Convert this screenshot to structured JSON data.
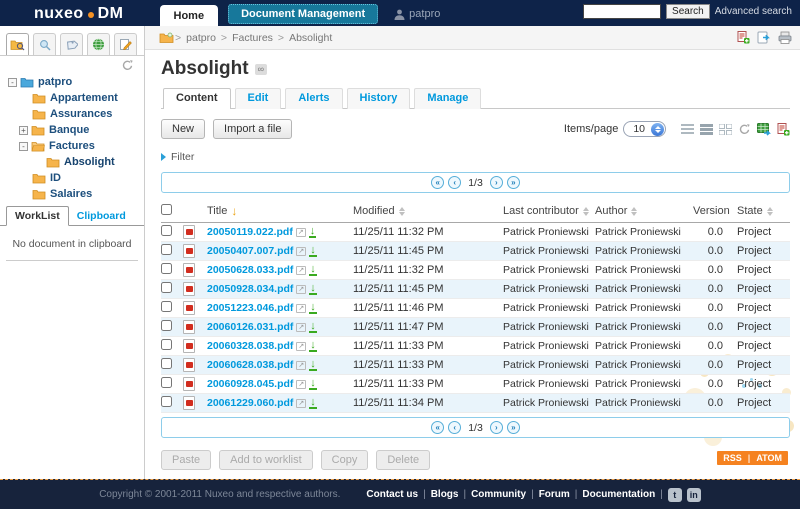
{
  "header": {
    "logo_primary": "nuxeo",
    "logo_secondary": "DM",
    "nav_tabs": [
      {
        "label": "Home"
      },
      {
        "label": "Document Management"
      }
    ],
    "username": "patpro",
    "search_button": "Search",
    "advanced_search": "Advanced search"
  },
  "breadcrumb": {
    "sep": ">",
    "items": [
      {
        "label": "patpro"
      },
      {
        "label": "Factures"
      },
      {
        "label": "Absolight"
      }
    ]
  },
  "sidebar": {
    "tree": [
      {
        "label": "patpro"
      },
      {
        "label": "Appartement"
      },
      {
        "label": "Assurances"
      },
      {
        "label": "Banque"
      },
      {
        "label": "Factures"
      },
      {
        "label": "Absolight"
      },
      {
        "label": "ID"
      },
      {
        "label": "Salaires"
      }
    ],
    "panel_tabs": [
      {
        "label": "WorkList"
      },
      {
        "label": "Clipboard"
      }
    ],
    "clipboard_empty": "No document in clipboard"
  },
  "main": {
    "title": "Absolight",
    "doc_tabs": [
      {
        "label": "Content"
      },
      {
        "label": "Edit"
      },
      {
        "label": "Alerts"
      },
      {
        "label": "History"
      },
      {
        "label": "Manage"
      }
    ],
    "new_button": "New",
    "import_button": "Import a file",
    "items_per_page_label": "Items/page",
    "items_per_page_value": "10",
    "filter_label": "Filter",
    "pagination": "1/3",
    "table": {
      "headers": {
        "title": "Title",
        "modified": "Modified",
        "contributor": "Last contributor",
        "author": "Author",
        "version": "Version",
        "state": "State"
      },
      "rows": [
        {
          "title": "20050119.022.pdf",
          "modified": "11/25/11 11:32 PM",
          "contributor": "Patrick Proniewski",
          "author": "Patrick Proniewski",
          "version": "0.0",
          "state": "Project"
        },
        {
          "title": "20050407.007.pdf",
          "modified": "11/25/11 11:45 PM",
          "contributor": "Patrick Proniewski",
          "author": "Patrick Proniewski",
          "version": "0.0",
          "state": "Project"
        },
        {
          "title": "20050628.033.pdf",
          "modified": "11/25/11 11:32 PM",
          "contributor": "Patrick Proniewski",
          "author": "Patrick Proniewski",
          "version": "0.0",
          "state": "Project"
        },
        {
          "title": "20050928.034.pdf",
          "modified": "11/25/11 11:45 PM",
          "contributor": "Patrick Proniewski",
          "author": "Patrick Proniewski",
          "version": "0.0",
          "state": "Project"
        },
        {
          "title": "20051223.046.pdf",
          "modified": "11/25/11 11:46 PM",
          "contributor": "Patrick Proniewski",
          "author": "Patrick Proniewski",
          "version": "0.0",
          "state": "Project"
        },
        {
          "title": "20060126.031.pdf",
          "modified": "11/25/11 11:47 PM",
          "contributor": "Patrick Proniewski",
          "author": "Patrick Proniewski",
          "version": "0.0",
          "state": "Project"
        },
        {
          "title": "20060328.038.pdf",
          "modified": "11/25/11 11:33 PM",
          "contributor": "Patrick Proniewski",
          "author": "Patrick Proniewski",
          "version": "0.0",
          "state": "Project"
        },
        {
          "title": "20060628.038.pdf",
          "modified": "11/25/11 11:33 PM",
          "contributor": "Patrick Proniewski",
          "author": "Patrick Proniewski",
          "version": "0.0",
          "state": "Project"
        },
        {
          "title": "20060928.045.pdf",
          "modified": "11/25/11 11:33 PM",
          "contributor": "Patrick Proniewski",
          "author": "Patrick Proniewski",
          "version": "0.0",
          "state": "Project"
        },
        {
          "title": "20061229.060.pdf",
          "modified": "11/25/11 11:34 PM",
          "contributor": "Patrick Proniewski",
          "author": "Patrick Proniewski",
          "version": "0.0",
          "state": "Project"
        }
      ]
    },
    "actions": [
      {
        "label": "Paste"
      },
      {
        "label": "Add to worklist"
      },
      {
        "label": "Copy"
      },
      {
        "label": "Delete"
      }
    ],
    "rss_label": "RSS",
    "atom_label": "ATOM"
  },
  "footer": {
    "copyright": "Copyright © 2001-2011 Nuxeo and respective authors.",
    "separator": "|",
    "links": [
      {
        "label": "Contact us"
      },
      {
        "label": "Blogs"
      },
      {
        "label": "Community"
      },
      {
        "label": "Forum"
      },
      {
        "label": "Documentation"
      }
    ]
  },
  "icons": {
    "collapse": "-",
    "expand": "+",
    "first": "«",
    "prev": "‹",
    "next": "›",
    "last": "»",
    "sort_active": "↓",
    "external": "↗",
    "download": "↓",
    "permalink": "∞",
    "twitter": "t",
    "linkedin": "in"
  },
  "colors": {
    "header_navy": "#0e2349",
    "active_module_teal": "#17789b",
    "link_blue": "#0099dd",
    "row_alt_blue": "#e9f4fb",
    "rss_orange": "#f58220",
    "pagination_border": "#8ecdea"
  }
}
